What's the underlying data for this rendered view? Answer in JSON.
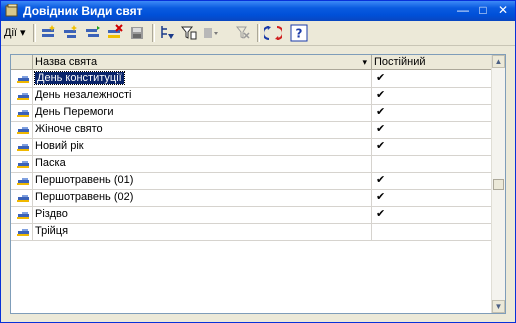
{
  "window": {
    "title": "Довідник Види свят"
  },
  "toolbar": {
    "actions_label": "Дії",
    "actions_arrow": "▾"
  },
  "grid": {
    "columns": [
      "Назва свята",
      "Постійний"
    ],
    "sort_indicator": "▾",
    "rows": [
      {
        "name": "День конституції",
        "permanent": "✔",
        "selected": true
      },
      {
        "name": "День незалежності",
        "permanent": "✔"
      },
      {
        "name": "День Перемоги",
        "permanent": "✔"
      },
      {
        "name": "Жіноче свято",
        "permanent": "✔"
      },
      {
        "name": "Новий рік",
        "permanent": "✔"
      },
      {
        "name": "Паска",
        "permanent": ""
      },
      {
        "name": "Першотравень (01)",
        "permanent": "✔"
      },
      {
        "name": "Першотравень (02)",
        "permanent": "✔"
      },
      {
        "name": "Різдво",
        "permanent": "✔"
      },
      {
        "name": "Трійця",
        "permanent": ""
      }
    ]
  },
  "colors": {
    "titlebar": "#0a5be0",
    "selection": "#0a246a",
    "grid_border": "#7f9db9"
  }
}
